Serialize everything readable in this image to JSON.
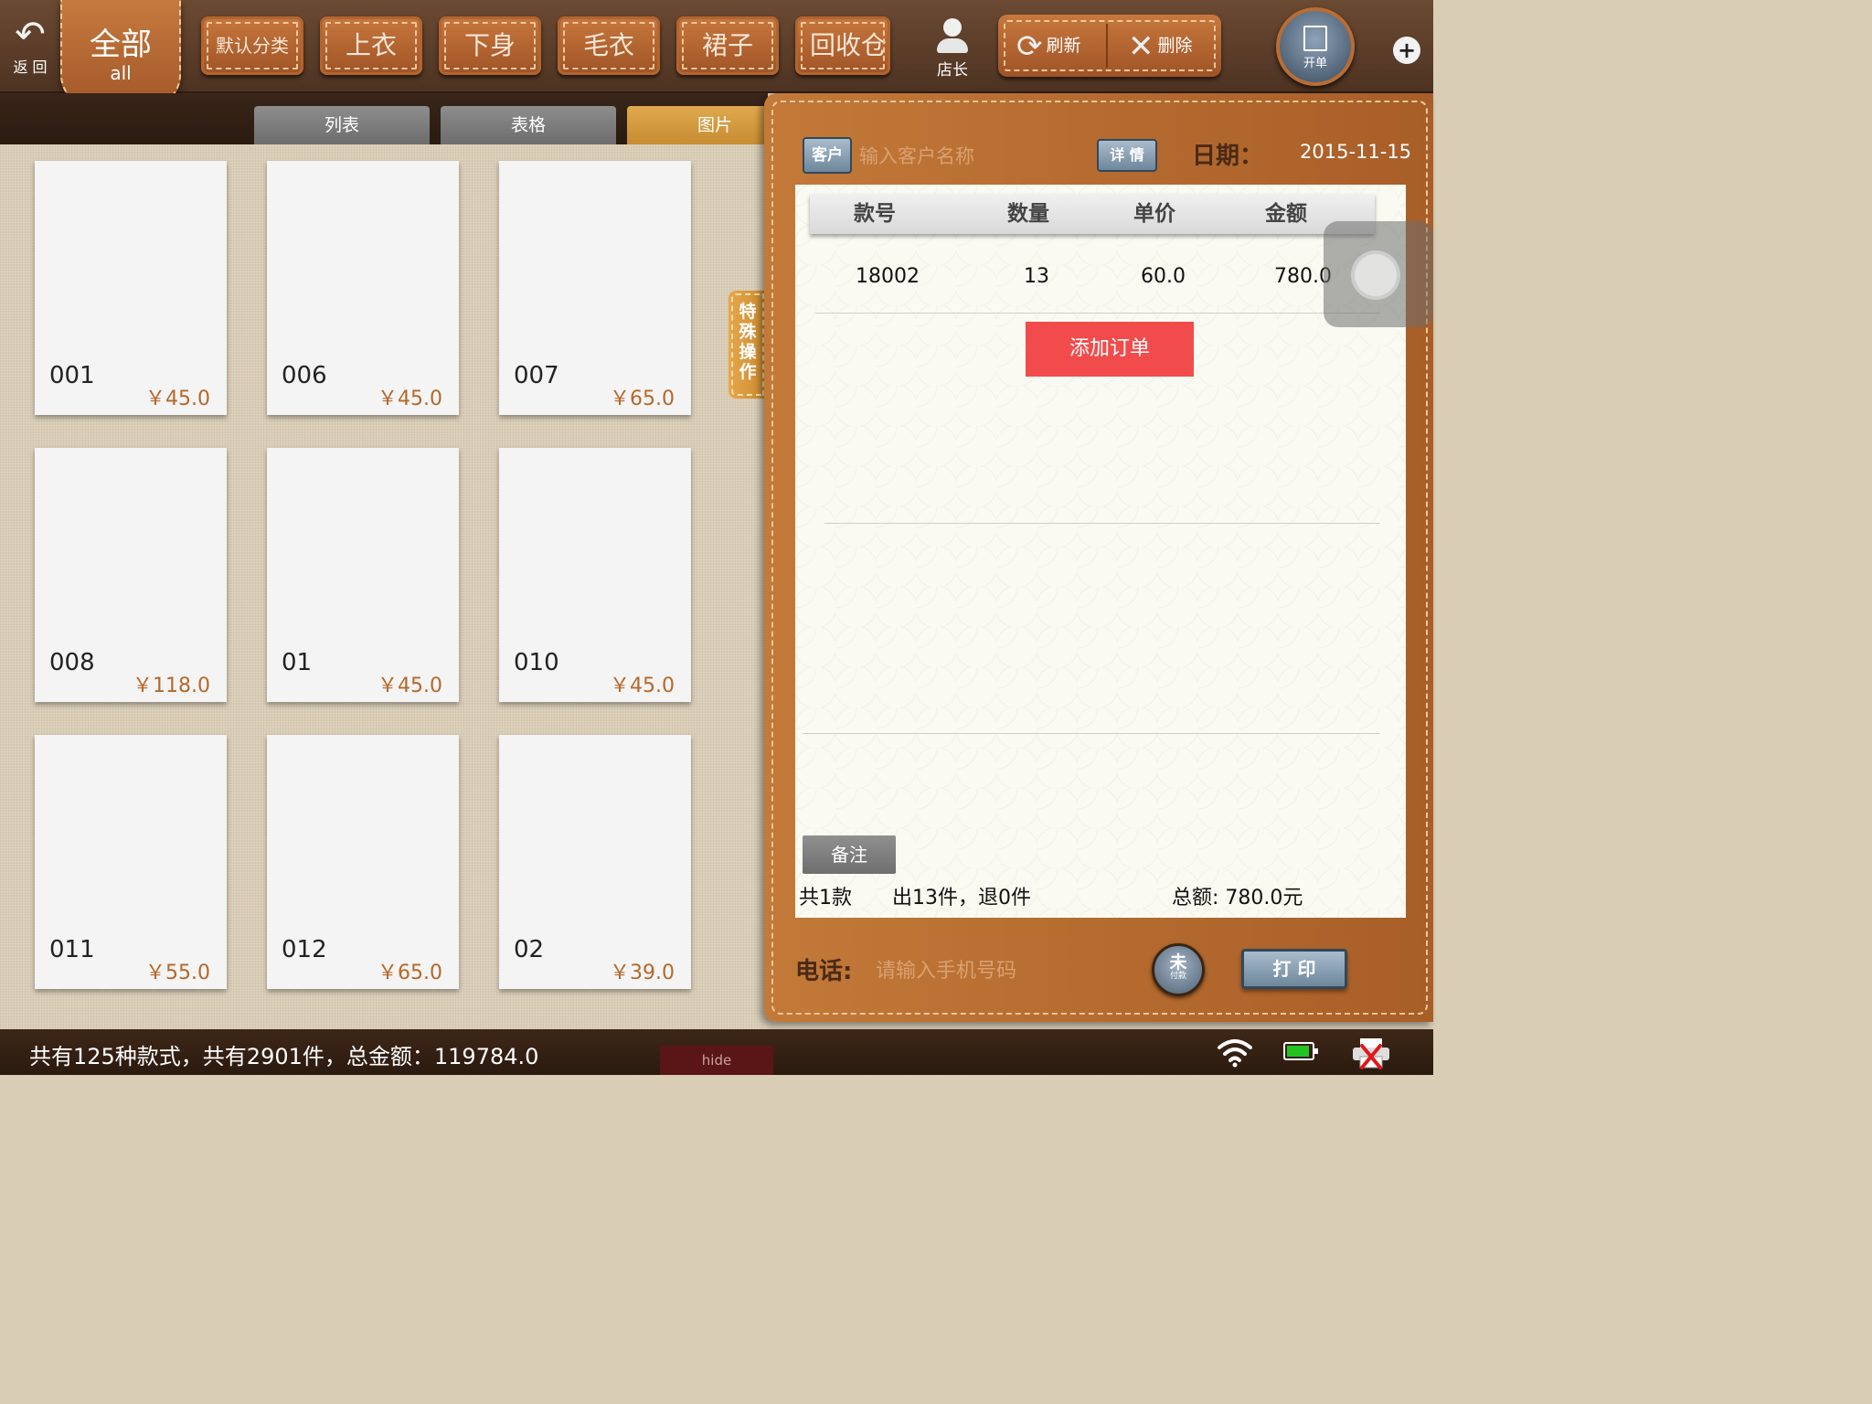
{
  "topbar": {
    "back_label": "返 回",
    "all_tab": {
      "title": "全部",
      "subtitle": "all"
    },
    "categories": [
      "默认分类",
      "上衣",
      "下身",
      "毛衣",
      "裙子",
      "回收仓"
    ],
    "manager_label": "店长",
    "refresh_label": "刷新",
    "delete_label": "删除",
    "open_order_label": "开单",
    "add_label": "+"
  },
  "view_tabs": {
    "items": [
      "列表",
      "表格",
      "图片"
    ],
    "active": "图片"
  },
  "products": [
    {
      "code": "001",
      "price": "￥45.0"
    },
    {
      "code": "006",
      "price": "￥45.0"
    },
    {
      "code": "007",
      "price": "￥65.0"
    },
    {
      "code": "008",
      "price": "￥118.0"
    },
    {
      "code": "01",
      "price": "￥45.0"
    },
    {
      "code": "010",
      "price": "￥45.0"
    },
    {
      "code": "011",
      "price": "￥55.0"
    },
    {
      "code": "012",
      "price": "￥65.0"
    },
    {
      "code": "02",
      "price": "￥39.0"
    }
  ],
  "special_op": {
    "label": "特殊操作"
  },
  "order": {
    "customer_button": "客户",
    "customer_placeholder": "输入客户名称",
    "detail_button": "详 情",
    "date_label": "日期：",
    "date_value": "2015-11-15",
    "columns": [
      "款号",
      "数量",
      "单价",
      "金额"
    ],
    "rows": [
      {
        "code": "18002",
        "qty": "13",
        "unit_price": "60.0",
        "amount": "780.0"
      }
    ],
    "add_order_button": "添加订单",
    "remark_button": "备注",
    "summary_count": "共1款",
    "summary_items": "出13件，退0件",
    "summary_total": "总额:   780.0元",
    "phone_label": "电话:",
    "phone_placeholder": "请输入手机号码",
    "unpaid_main": "未",
    "unpaid_sub": "付款",
    "print_button": "打 印"
  },
  "statusbar": {
    "summary": "共有125种款式，共有2901件，总金额：119784.0",
    "hide_label": "hide"
  },
  "colors": {
    "leather": "#b06428",
    "add_order": "#f24b4b",
    "price": "#b5682a",
    "active_tab": "#d69a3e"
  },
  "icons": {
    "back": "back-arrow-icon",
    "manager": "person-icon",
    "refresh": "refresh-icon",
    "delete": "x-icon",
    "open_order": "document-icon",
    "wifi": "wifi-icon",
    "battery": "battery-icon",
    "printer": "printer-disconnected-icon"
  }
}
